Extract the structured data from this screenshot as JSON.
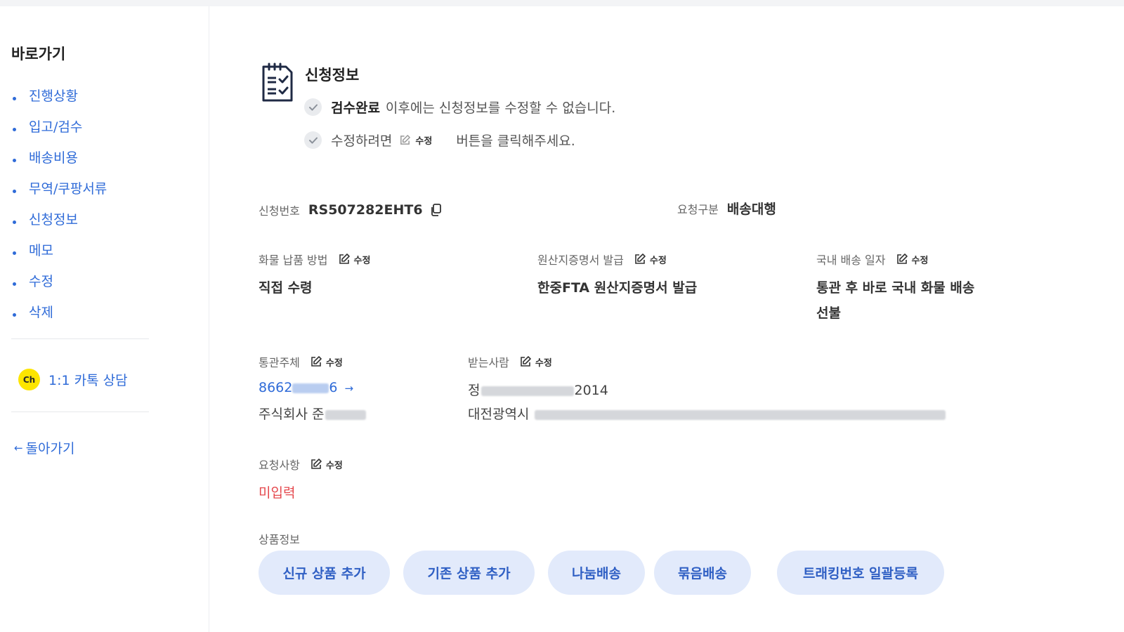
{
  "sidebar": {
    "title": "바로가기",
    "items": [
      {
        "label": "진행상황"
      },
      {
        "label": "입고/검수"
      },
      {
        "label": "배송비용"
      },
      {
        "label": "무역/쿠팡서류"
      },
      {
        "label": "신청정보"
      },
      {
        "label": "메모"
      },
      {
        "label": "수정"
      },
      {
        "label": "삭제"
      }
    ],
    "kakao": {
      "badge": "Ch",
      "label": "1:1 카톡 상담"
    },
    "back": {
      "arrow": "←",
      "label": "돌아가기"
    }
  },
  "section": {
    "title": "신청정보",
    "note1": {
      "bold": "검수완료",
      "rest": "이후에는 신청정보를 수정할 수 없습니다."
    },
    "note2": {
      "prefix": "수정하려면",
      "edit": "수정",
      "suffix": "버튼을 클릭해주세요."
    }
  },
  "info": {
    "edit_label": "수정",
    "app_number": {
      "label": "신청번호",
      "value": "RS507282EHT6"
    },
    "request_type": {
      "label": "요청구분",
      "value": "배송대행"
    },
    "delivery_method": {
      "label": "화물 납품 방법",
      "value": "직접 수령"
    },
    "origin_cert": {
      "label": "원산지증명서 발급",
      "value": "한중FTA 원산지증명서 발급"
    },
    "domestic_shipping": {
      "label": "국내 배송 일자",
      "value_line1": "통관 후 바로 국내 화물 배송",
      "value_line2": "선불"
    },
    "customs_entity": {
      "label": "통관주체",
      "id_prefix": "8662",
      "id_suffix": "6",
      "arrow": "→",
      "company_prefix": "주식회사 준"
    },
    "recipient": {
      "label": "받는사람",
      "name_prefix": "정",
      "phone_suffix": "2014",
      "address_prefix": "대전광역시"
    },
    "request": {
      "label": "요청사항",
      "value": "미입력"
    },
    "products": {
      "label": "상품정보"
    }
  },
  "buttons": {
    "new_product": "신규 상품 추가",
    "existing_product": "기존 상품 추가",
    "split": "나눔배송",
    "bundle": "묶음배송",
    "tracking": "트래킹번호 일괄등록"
  },
  "colors": {
    "accent": "#2f6bd8",
    "pill_bg": "#e2eafb",
    "error": "#e5484d",
    "kakao": "#fde500"
  }
}
